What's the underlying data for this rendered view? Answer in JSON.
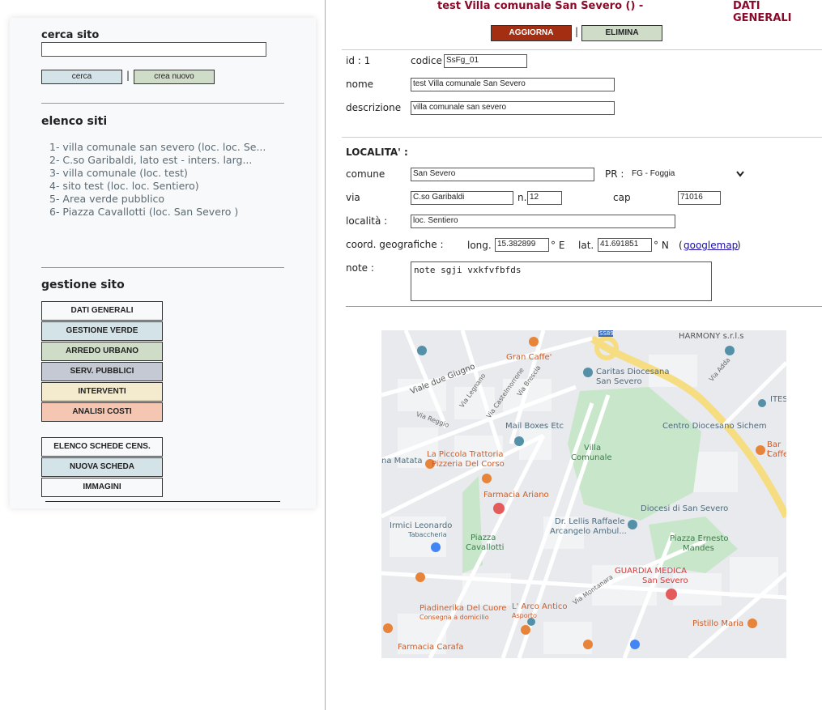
{
  "search": {
    "heading": "cerca sito",
    "value": "",
    "search_label": "cerca",
    "separator": "|",
    "create_label": "crea nuovo"
  },
  "sites": {
    "heading": "elenco siti",
    "items": [
      "1- villa comunale san severo (loc. loc. Se...",
      "2- C.so Garibaldi, lato est - inters. larg...",
      "3- villa comunale (loc. test)",
      "4- sito test (loc. loc. Sentiero)",
      "5- Area verde pubblico",
      "6- Piazza Cavallotti (loc. San Severo )"
    ]
  },
  "management": {
    "heading": "gestione sito",
    "menu": [
      {
        "label": "DATI GENERALI",
        "color": "#ffffff"
      },
      {
        "label": "GESTIONE VERDE",
        "color": "#d3e3e8"
      },
      {
        "label": "ARREDO URBANO",
        "color": "#cfdcc8"
      },
      {
        "label": "SERV. PUBBLICI",
        "color": "#c5c9d3"
      },
      {
        "label": "INTERVENTI",
        "color": "#f4ebcf"
      },
      {
        "label": "ANALISI COSTI",
        "color": "#f5c6b2"
      }
    ],
    "menu2": [
      {
        "label": "ELENCO SCHEDE CENS.",
        "color": "#ffffff"
      },
      {
        "label": "NUOVA SCHEDA",
        "color": "#d3e3e8"
      },
      {
        "label": "IMMAGINI",
        "color": "#ffffff"
      }
    ]
  },
  "header": {
    "title": "test Villa comunale San Severo () -",
    "section": "DATI GENERALI",
    "update_label": "AGGIORNA",
    "separator": "|",
    "delete_label": "ELIMINA"
  },
  "general": {
    "id_label": "id : 1",
    "code_label": "codice",
    "code_value": "SsFg_01",
    "name_label": "nome",
    "name_value": "test Villa comunale San Severo",
    "desc_label": "descrizione",
    "desc_value": "villa comunale san severo"
  },
  "location": {
    "heading": "LOCALITA' :",
    "comune_label": "comune",
    "comune_value": "San Severo",
    "pr_label": "PR :",
    "pr_value": "FG - Foggia",
    "via_label": "via",
    "via_value": "C.so Garibaldi",
    "n_label": "n.",
    "n_value": "12",
    "cap_label": "cap",
    "cap_value": "71016",
    "localita_label": "località :",
    "localita_value": "loc. Sentiero",
    "coord_label": "coord. geografiche :",
    "long_label": "long.",
    "long_value": "15.382899",
    "east_label": "° E",
    "lat_label": "lat.",
    "lat_value": "41.691851",
    "north_label": "° N",
    "gmap_open": "(",
    "gmap_label": "googlemap",
    "gmap_close": ")",
    "note_label": "note :",
    "note_value": "note sgji vxkfvfbfds"
  },
  "map": {
    "labels": [
      "Gran Caffe'",
      "Caritas Diocesana",
      "San Severo",
      "HARMONY s.r.l.s",
      "Viale due Giugno",
      "Via Legnano",
      "Via Castelmorrone",
      "Via Brescia",
      "Via Reggio",
      "Mail Boxes Etc",
      "Villa",
      "Comunale",
      "Centro Diocesano Sichem",
      "La Piccola Trattoria",
      "Pizzeria Del Corso",
      "Farmacia Ariano",
      "Irmici Leonardo",
      "Tabaccheria",
      "Piazza",
      "Cavallotti",
      "Dr. Lellis Raffaele",
      "Arcangelo Ambul...",
      "Diocesi di San Severo",
      "Piazza Ernesto",
      "Mandes",
      "GUARDIA MEDICA",
      "San Severo",
      "Piadinerika Del Cuore",
      "Consegna a domicilio",
      "L' Arco Antico",
      "Asporto",
      "Via Montanara",
      "Pistillo Maria",
      "Farmacia Carafa",
      "ITES",
      "Bar t",
      "Caffe",
      "Via Adda",
      "SS89",
      "na Matata",
      "Via Adda"
    ]
  }
}
